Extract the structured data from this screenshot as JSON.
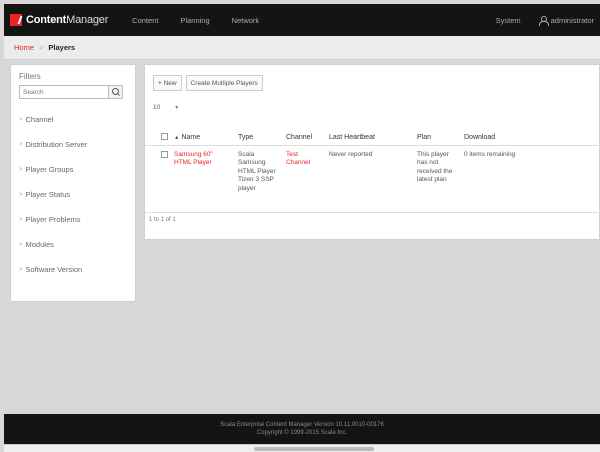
{
  "app": {
    "logo_bold": "Content",
    "logo_thin": "Manager",
    "nav": [
      "Content",
      "Planning",
      "Network"
    ],
    "system": "System",
    "user": "administrator"
  },
  "breadcrumb": {
    "home": "Home",
    "current": "Players"
  },
  "sidebar": {
    "title": "Filters",
    "search_placeholder": "Search",
    "filters": [
      "Channel",
      "Distribution Server",
      "Player Groups",
      "Player Status",
      "Player Problems",
      "Modules",
      "Software Version"
    ]
  },
  "main": {
    "new_button": "+ New",
    "create_multiple_button": "Create Multiple Players",
    "page_size": "10",
    "columns": [
      "Name",
      "Type",
      "Channel",
      "Last Heartbeat",
      "Plan",
      "Download"
    ],
    "rows": [
      {
        "name": "Samsung 60\" HTML Player",
        "type": "Scala Samsung HTML Player Tizen 3 SSP player",
        "channel": "Test Channel",
        "heartbeat": "Never reported",
        "plan": "This player has not received the latest plan",
        "download": "0 items remaining"
      }
    ],
    "pager": "1 to 1 of 1"
  },
  "footer": {
    "line1": "Scala Enterprise Content Manager Version 10.11.0010-00176",
    "line2": "Copyright © 1999-2015 Scala Inc."
  },
  "colors": {
    "accent": "#e8232b",
    "topbar": "#141414"
  }
}
